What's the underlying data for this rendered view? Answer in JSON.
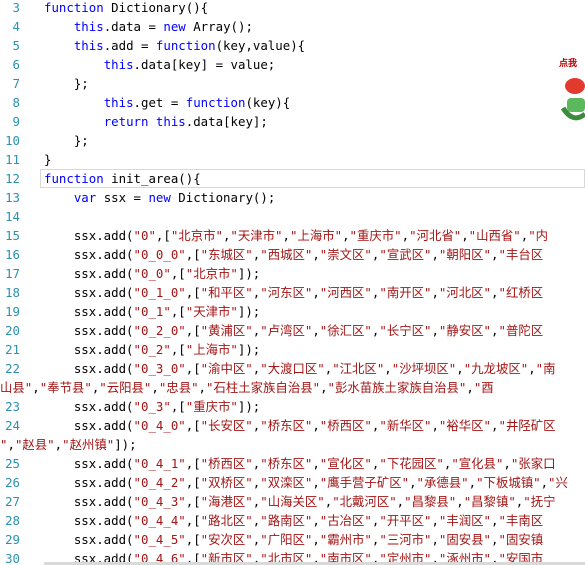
{
  "editor": {
    "lines": [
      {
        "n": "3",
        "html": "<span class='kw'>function</span> Dictionary(){"
      },
      {
        "n": "4",
        "html": "    <span class='kw'>this</span>.data = <span class='kw'>new</span> Array();"
      },
      {
        "n": "5",
        "html": "    <span class='kw'>this</span>.add = <span class='kw'>function</span>(key,value){"
      },
      {
        "n": "6",
        "html": "        <span class='kw'>this</span>.data[key] = value;"
      },
      {
        "n": "7",
        "html": "    };"
      },
      {
        "n": "8",
        "html": "        <span class='kw'>this</span>.get = <span class='kw'>function</span>(key){"
      },
      {
        "n": "9",
        "html": "        <span class='kw'>return</span> <span class='kw'>this</span>.data[key];"
      },
      {
        "n": "10",
        "html": "    };"
      },
      {
        "n": "11",
        "html": "}"
      },
      {
        "n": "12",
        "html": "<span class='kw'>function</span> init_area(){"
      },
      {
        "n": "13",
        "html": "    <span class='kw'>var</span> ssx = <span class='kw'>new</span> Dictionary();"
      },
      {
        "n": "14",
        "html": ""
      },
      {
        "n": "15",
        "html": "    ssx.add(<span class='st'>\"0\"</span>,[<span class='st'>\"北京市\"</span>,<span class='st'>\"天津市\"</span>,<span class='st'>\"上海市\"</span>,<span class='st'>\"重庆市\"</span>,<span class='st'>\"河北省\"</span>,<span class='st'>\"山西省\"</span>,<span class='st'>\"内</span>"
      },
      {
        "n": "16",
        "html": "    ssx.add(<span class='st'>\"0_0_0\"</span>,[<span class='st'>\"东城区\"</span>,<span class='st'>\"西城区\"</span>,<span class='st'>\"崇文区\"</span>,<span class='st'>\"宣武区\"</span>,<span class='st'>\"朝阳区\"</span>,<span class='st'>\"丰台区</span>"
      },
      {
        "n": "17",
        "html": "    ssx.add(<span class='st'>\"0_0\"</span>,[<span class='st'>\"北京市\"</span>]);"
      },
      {
        "n": "18",
        "html": "    ssx.add(<span class='st'>\"0_1_0\"</span>,[<span class='st'>\"和平区\"</span>,<span class='st'>\"河东区\"</span>,<span class='st'>\"河西区\"</span>,<span class='st'>\"南开区\"</span>,<span class='st'>\"河北区\"</span>,<span class='st'>\"红桥区</span>"
      },
      {
        "n": "19",
        "html": "    ssx.add(<span class='st'>\"0_1\"</span>,[<span class='st'>\"天津市\"</span>]);"
      },
      {
        "n": "20",
        "html": "    ssx.add(<span class='st'>\"0_2_0\"</span>,[<span class='st'>\"黄浦区\"</span>,<span class='st'>\"卢湾区\"</span>,<span class='st'>\"徐汇区\"</span>,<span class='st'>\"长宁区\"</span>,<span class='st'>\"静安区\"</span>,<span class='st'>\"普陀区</span>"
      },
      {
        "n": "21",
        "html": "    ssx.add(<span class='st'>\"0_2\"</span>,[<span class='st'>\"上海市\"</span>]);"
      },
      {
        "n": "22",
        "html": "    ssx.add(<span class='st'>\"0_3_0\"</span>,[<span class='st'>\"渝中区\"</span>,<span class='st'>\"大渡口区\"</span>,<span class='st'>\"江北区\"</span>,<span class='st'>\"沙坪坝区\"</span>,<span class='st'>\"九龙坡区\"</span>,<span class='st'>\"南</span>"
      },
      {
        "n": "",
        "html": "<span class='st'>山县\"</span>,<span class='st'>\"奉节县\"</span>,<span class='st'>\"云阳县\"</span>,<span class='st'>\"忠县\"</span>,<span class='st'>\"石柱土家族自治县\"</span>,<span class='st'>\"彭水苗族土家族自治县\"</span>,<span class='st'>\"酉</span>",
        "cont": true
      },
      {
        "n": "23",
        "html": "    ssx.add(<span class='st'>\"0_3\"</span>,[<span class='st'>\"重庆市\"</span>]);"
      },
      {
        "n": "24",
        "html": "    ssx.add(<span class='st'>\"0_4_0\"</span>,[<span class='st'>\"长安区\"</span>,<span class='st'>\"桥东区\"</span>,<span class='st'>\"桥西区\"</span>,<span class='st'>\"新华区\"</span>,<span class='st'>\"裕华区\"</span>,<span class='st'>\"井陉矿区</span>"
      },
      {
        "n": "",
        "html": "<span class='st'>\"</span>,<span class='st'>\"赵县\"</span>,<span class='st'>\"赵州镇\"</span>]);",
        "cont": true
      },
      {
        "n": "25",
        "html": "    ssx.add(<span class='st'>\"0_4_1\"</span>,[<span class='st'>\"桥西区\"</span>,<span class='st'>\"桥东区\"</span>,<span class='st'>\"宣化区\"</span>,<span class='st'>\"下花园区\"</span>,<span class='st'>\"宣化县\"</span>,<span class='st'>\"张家口</span>"
      },
      {
        "n": "26",
        "html": "    ssx.add(<span class='st'>\"0_4_2\"</span>,[<span class='st'>\"双桥区\"</span>,<span class='st'>\"双滦区\"</span>,<span class='st'>\"鹰手营子矿区\"</span>,<span class='st'>\"承德县\"</span>,<span class='st'>\"下板城镇\"</span>,<span class='st'>\"兴</span>"
      },
      {
        "n": "27",
        "html": "    ssx.add(<span class='st'>\"0_4_3\"</span>,[<span class='st'>\"海港区\"</span>,<span class='st'>\"山海关区\"</span>,<span class='st'>\"北戴河区\"</span>,<span class='st'>\"昌黎县\"</span>,<span class='st'>\"昌黎镇\"</span>,<span class='st'>\"抚宁</span>"
      },
      {
        "n": "28",
        "html": "    ssx.add(<span class='st'>\"0_4_4\"</span>,[<span class='st'>\"路北区\"</span>,<span class='st'>\"路南区\"</span>,<span class='st'>\"古冶区\"</span>,<span class='st'>\"开平区\"</span>,<span class='st'>\"丰润区\"</span>,<span class='st'>\"丰南区</span>"
      },
      {
        "n": "29",
        "html": "    ssx.add(<span class='st'>\"0_4_5\"</span>,[<span class='st'>\"安次区\"</span>,<span class='st'>\"广阳区\"</span>,<span class='st'>\"霸州市\"</span>,<span class='st'>\"三河市\"</span>,<span class='st'>\"固安县\"</span>,<span class='st'>\"固安镇</span>"
      },
      {
        "n": "30",
        "html": "    ssx.add(<span class='st'>\"0_4_6\"</span>,[<span class='st'>\"新市区\"</span>,<span class='st'>\"北市区\"</span>,<span class='st'>\"南市区\"</span>,<span class='st'>\"定州市\"</span>,<span class='st'>\"涿州市\"</span>,<span class='st'>\"安国市</span>"
      }
    ],
    "current_line_index": 9
  },
  "badge": {
    "text": "点我"
  }
}
